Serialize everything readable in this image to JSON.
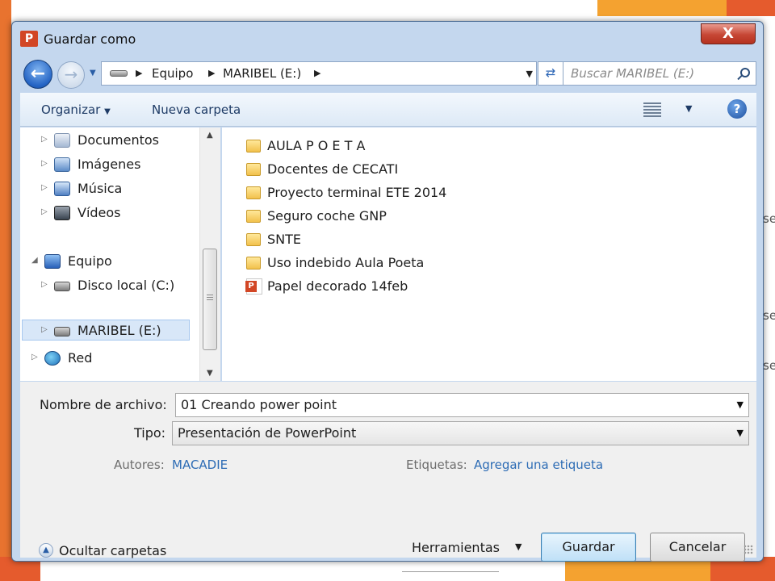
{
  "window": {
    "title": "Guardar como",
    "close_label": "X"
  },
  "address": {
    "crumbs": [
      "Equipo",
      "MARIBEL (E:)"
    ],
    "search_placeholder": "Buscar MARIBEL (E:)"
  },
  "toolbar": {
    "organize_label": "Organizar",
    "new_folder_label": "Nueva carpeta",
    "help_label": "?"
  },
  "nav": {
    "items": [
      {
        "label": "Documentos",
        "icon": "documents-icon"
      },
      {
        "label": "Imágenes",
        "icon": "pictures-icon"
      },
      {
        "label": "Música",
        "icon": "music-icon"
      },
      {
        "label": "Vídeos",
        "icon": "videos-icon"
      },
      {
        "label": "Equipo",
        "icon": "computer-icon"
      },
      {
        "label": "Disco local (C:)",
        "icon": "local-disk-icon"
      },
      {
        "label": "MARIBEL (E:)",
        "icon": "removable-drive-icon",
        "selected": true
      },
      {
        "label": "Red",
        "icon": "network-icon"
      }
    ]
  },
  "files": [
    {
      "name": "AULA P O E T A",
      "type": "folder"
    },
    {
      "name": "Docentes de CECATI",
      "type": "folder"
    },
    {
      "name": "Proyecto terminal ETE 2014",
      "type": "folder"
    },
    {
      "name": "Seguro coche GNP",
      "type": "folder"
    },
    {
      "name": "SNTE",
      "type": "folder"
    },
    {
      "name": "Uso indebido Aula Poeta",
      "type": "folder"
    },
    {
      "name": "Papel decorado 14feb",
      "type": "powerpoint"
    }
  ],
  "form": {
    "filename_label": "Nombre de archivo:",
    "filename_value": "01 Creando power point",
    "type_label": "Tipo:",
    "type_value": "Presentación de PowerPoint",
    "authors_label": "Autores:",
    "authors_value": "MACADIE",
    "tags_label": "Etiquetas:",
    "tags_value": "Agregar una etiqueta",
    "hide_folders_label": "Ocultar carpetas",
    "tools_label": "Herramientas",
    "save_label": "Guardar",
    "cancel_label": "Cancelar"
  },
  "background": {
    "partial_text": [
      "se",
      "se",
      "se"
    ]
  },
  "colors": {
    "accent_orange": "#f4a230",
    "accent_red": "#e55b2d",
    "window_frame": "#c4d7ee",
    "link_blue": "#2d6cb5"
  }
}
